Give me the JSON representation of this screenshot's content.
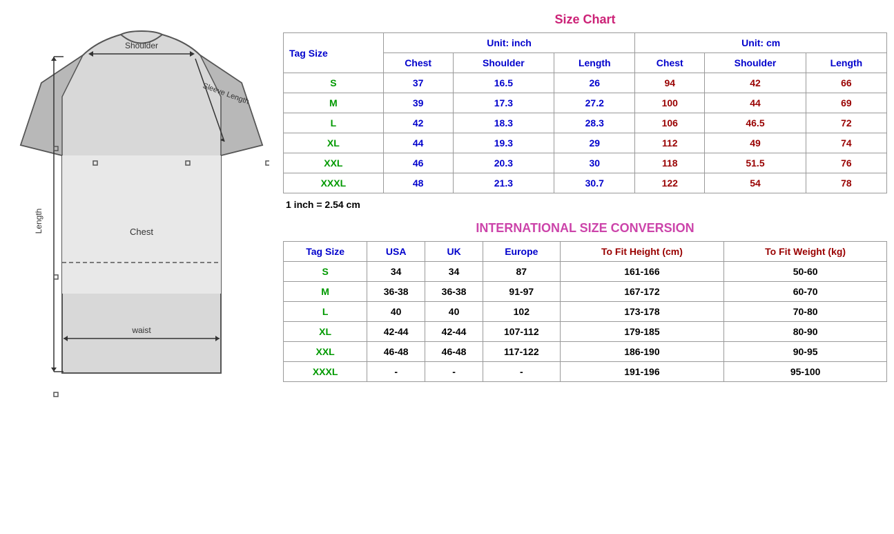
{
  "sizeChart": {
    "title": "Size Chart",
    "conversionNote": "1 inch = 2.54 cm",
    "unitInch": "Unit: inch",
    "unitCm": "Unit: cm",
    "tagSizeLabel": "Tag Size",
    "headers": {
      "inch": [
        "Chest",
        "Shoulder",
        "Length"
      ],
      "cm": [
        "Chest",
        "Shoulder",
        "Length"
      ]
    },
    "rows": [
      {
        "tag": "S",
        "inch": [
          "37",
          "16.5",
          "26"
        ],
        "cm": [
          "94",
          "42",
          "66"
        ]
      },
      {
        "tag": "M",
        "inch": [
          "39",
          "17.3",
          "27.2"
        ],
        "cm": [
          "100",
          "44",
          "69"
        ]
      },
      {
        "tag": "L",
        "inch": [
          "42",
          "18.3",
          "28.3"
        ],
        "cm": [
          "106",
          "46.5",
          "72"
        ]
      },
      {
        "tag": "XL",
        "inch": [
          "44",
          "19.3",
          "29"
        ],
        "cm": [
          "112",
          "49",
          "74"
        ]
      },
      {
        "tag": "XXL",
        "inch": [
          "46",
          "20.3",
          "30"
        ],
        "cm": [
          "118",
          "51.5",
          "76"
        ]
      },
      {
        "tag": "XXXL",
        "inch": [
          "48",
          "21.3",
          "30.7"
        ],
        "cm": [
          "122",
          "54",
          "78"
        ]
      }
    ]
  },
  "intlConversion": {
    "title": "INTERNATIONAL SIZE CONVERSION",
    "tagSizeLabel": "Tag Size",
    "headers": [
      "USA",
      "UK",
      "Europe",
      "To Fit Height (cm)",
      "To Fit Weight (kg)"
    ],
    "rows": [
      {
        "tag": "S",
        "usa": "34",
        "uk": "34",
        "europe": "87",
        "height": "161-166",
        "weight": "50-60"
      },
      {
        "tag": "M",
        "usa": "36-38",
        "uk": "36-38",
        "europe": "91-97",
        "height": "167-172",
        "weight": "60-70"
      },
      {
        "tag": "L",
        "usa": "40",
        "uk": "40",
        "europe": "102",
        "height": "173-178",
        "weight": "70-80"
      },
      {
        "tag": "XL",
        "usa": "42-44",
        "uk": "42-44",
        "europe": "107-112",
        "height": "179-185",
        "weight": "80-90"
      },
      {
        "tag": "XXL",
        "usa": "46-48",
        "uk": "46-48",
        "europe": "117-122",
        "height": "186-190",
        "weight": "90-95"
      },
      {
        "tag": "XXXL",
        "usa": "-",
        "uk": "-",
        "europe": "-",
        "height": "191-196",
        "weight": "95-100"
      }
    ]
  },
  "diagram": {
    "labels": {
      "shoulder": "Shoulder",
      "sleeve": "Sleeve Length",
      "chest": "Chest",
      "length": "Length",
      "waist": "waist"
    }
  }
}
